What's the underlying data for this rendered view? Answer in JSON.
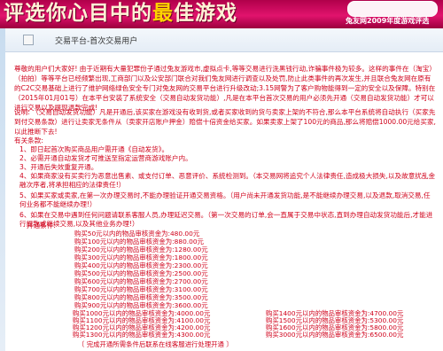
{
  "banner": {
    "slogan_pre": "评选你心目中的",
    "slogan_highlight": "最",
    "slogan_post": "佳游戏",
    "tagline": "兔友网2009年度游戏评选"
  },
  "breadcrumb": {
    "text": "交易平台-首次交易用户"
  },
  "intro": "尊敬的用户们大家好! 由于近期有大量犯罪份子通过兔友游戏市,虚拟点卡,等等交易进行洗黑钱行动,诈骗事件极为较多。这样的事件在（淘宝）（拍拍）等等平台已经频繁出现,工商部门以及公安部门联合对我们兔友网进行调查以及处罚,防止此类事件的再次发生,并且联合兔友网在原有的C2C交易基础上进行了维护网络绿色安全专门对兔友网的交易平台进行升级改动;3.15网警为了客户购物能得到一定的安全以及保障。特别在（2015年01月01号）在本平台安装了系统安全（交易自动发货功能）,凡是在本平台首次交易的用户必须先开通（交易自动发货功能）才可以进行交易以及提现退款完成!",
  "note": "说明: （交易自动发货功能）凡是开通后,该买家在游戏没有收到货,或者买家收到的货与卖家上架的不符合,那么本平台系统将自动执行（买家先到付交易条款）进行让卖家无条件从（卖家开店账户押金）赔偿十倍资金给买家。如果卖家上架了100元的商品,那么将赔偿1000.00元给买家,以此推断下去!",
  "notes_title": "有关条款:",
  "notes": [
    "1、即日起首次购买商品用户需开通《自动发货》。",
    "2、必需开通自动发货才可推送至指定运营商游戏账户内。",
    "3、开通后失效重复开通。",
    "4、如果商家没有买卖行为恶意出售素、或支付订单、恶意评价、系统检测到。（本交易网将追究个人法律责任,造成极大损失,以及故意扰乱金融次序者,将承担相应的法律责任!）",
    "5、如果买家或卖家,在第一次办理交易时,不能办理验证开通交易资格。（用户尚未开通发货功能,是不能继续办理交易,以及退款,取消交易,任何业务都不能继续办理!）",
    "6、如果在交易中遇到任何问题请联系客服人员,办理延迟交易。（第一次交易的订单,会一直属于交易中状态,直到办理自动发货功能后,才能进行提款或继续交易,以及其他业务办理!）"
  ],
  "fee_title": "开通条件:",
  "fees": [
    "购买50元以内的物品审核资金为:480.00元",
    "购买100元以内的物品审核资金为:880.00元",
    "购买200元以内的物品审核资金为:1280.00元",
    "购买300元以内的物品审核资金为:1800.00元",
    "购买400元以内的物品审核资金为:2300.00元",
    "购买500元以内的物品审核资金为:2500.00元",
    "购买600元以内的物品审核资金为:2700.00元",
    "购买700元以内的物品审核资金为:3100.00元",
    "购买800元以内的物品审核资金为:3500.00元",
    "购买900元以内的物品审核资金为:3600.00元",
    "购买1000元以内的物品审核资金为:4000.00元",
    "购买1100元以内的物品审核资金为:4100.00元",
    "购买1200元以内的物品审核资金为:4200.00元",
    "购买1300元以内的物品审核资金为:4300.00元",
    "购买1400元以内的物品审核资金为:4700.00元",
    "购买1500元以内的物品审核资金为:5300.00元",
    "购买1600元以内的物品审核资金为:5800.00元",
    "购买3000元以内的物品审核资金为:6500.00元"
  ],
  "footer": "〔 完成开通所需条件后联系在线客服进行处理开通 〕"
}
